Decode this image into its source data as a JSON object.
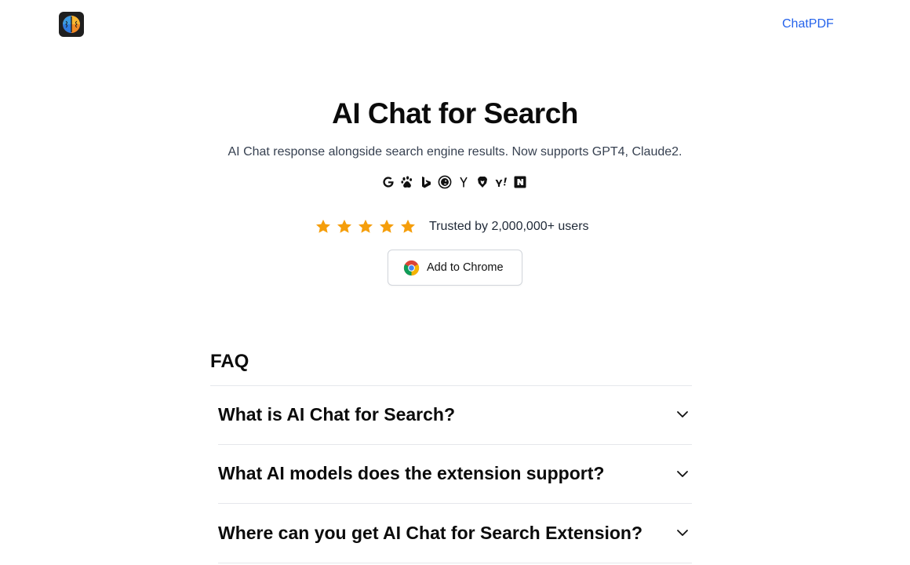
{
  "header": {
    "logo_icon": "brain-logo-icon",
    "nav_link": "ChatPDF"
  },
  "hero": {
    "title": "AI Chat for Search",
    "subtitle": "AI Chat response alongside search engine results. Now supports GPT4, Claude2.",
    "engines": [
      "google-icon",
      "baidu-icon",
      "bing-icon",
      "duckduckgo-icon",
      "yandex-icon",
      "brave-icon",
      "yahoo-icon",
      "naver-icon"
    ],
    "rating": {
      "stars": 5,
      "max": 5,
      "text": "Trusted by 2,000,000+ users"
    },
    "cta": {
      "label": "Add to Chrome",
      "icon": "chrome-icon"
    }
  },
  "faq": {
    "title": "FAQ",
    "items": [
      {
        "question": "What is AI Chat for Search?"
      },
      {
        "question": "What AI models does the extension support?"
      },
      {
        "question": "Where can you get AI Chat for Search Extension?"
      }
    ]
  },
  "colors": {
    "link": "#2563eb",
    "star": "#f59e0b",
    "border": "#e5e7eb"
  }
}
